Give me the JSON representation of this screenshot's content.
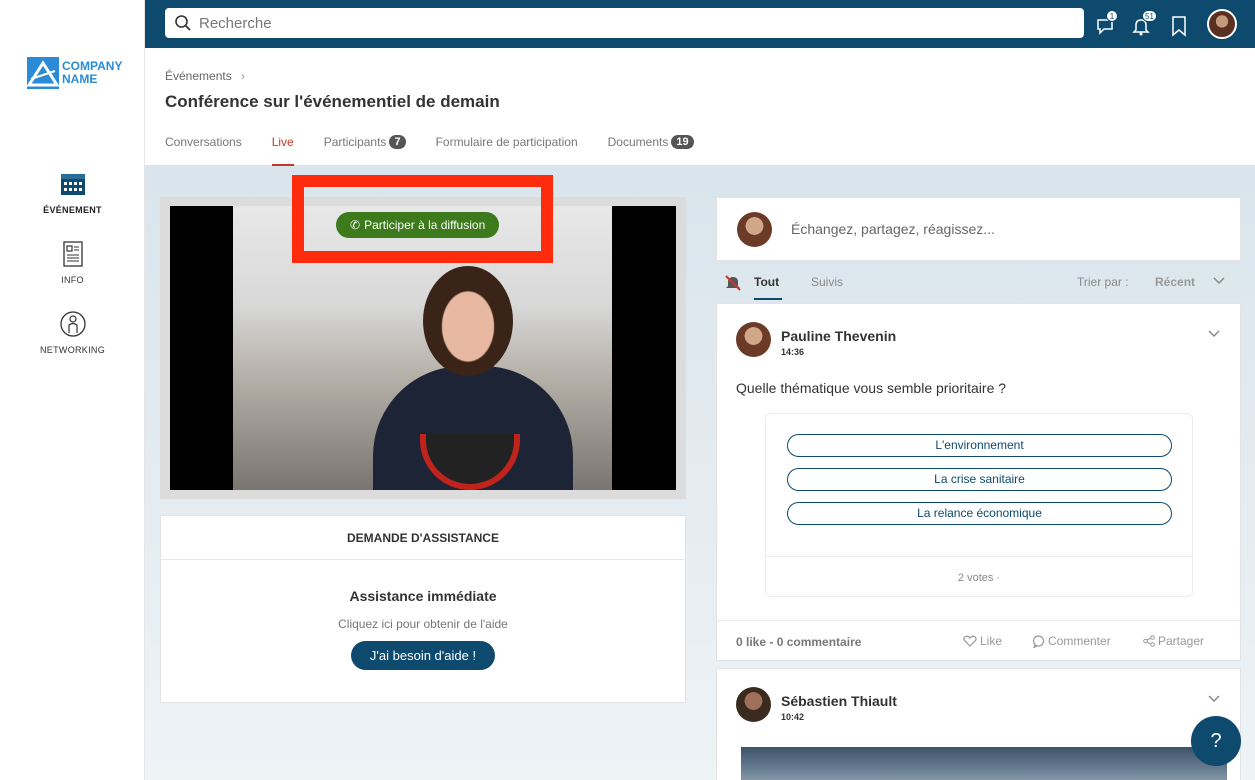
{
  "app": {
    "logo_line1": "COMPANY",
    "logo_line2": "NAME",
    "brand_color": "#0e4a6e",
    "accent_color": "#c0392b"
  },
  "sidebar": {
    "items": [
      {
        "label": "ÉVÉNEMENT",
        "icon": "calendar-icon",
        "active": true
      },
      {
        "label": "INFO",
        "icon": "document-icon",
        "active": false
      },
      {
        "label": "NETWORKING",
        "icon": "person-icon",
        "active": false
      }
    ]
  },
  "topbar": {
    "search_placeholder": "Recherche",
    "messages_count": "1",
    "notifications_count": "51"
  },
  "header": {
    "breadcrumb": "Événements",
    "title": "Conférence sur l'événementiel de demain",
    "tabs": [
      {
        "label": "Conversations",
        "count": null,
        "active": false
      },
      {
        "label": "Live",
        "count": null,
        "active": true
      },
      {
        "label": "Participants",
        "count": "7",
        "active": false
      },
      {
        "label": "Formulaire de participation",
        "count": null,
        "active": false
      },
      {
        "label": "Documents",
        "count": "19",
        "active": false
      }
    ]
  },
  "live": {
    "broadcast_button": "Participer à la diffusion"
  },
  "assistance": {
    "header": "DEMANDE D'ASSISTANCE",
    "title": "Assistance immédiate",
    "subtitle": "Cliquez ici pour obtenir de l'aide",
    "button": "J'ai besoin d'aide !"
  },
  "feed": {
    "composer_placeholder": "Échangez, partagez, réagissez...",
    "filter_all": "Tout",
    "filter_followed": "Suivis",
    "sort_label": "Trier par :",
    "sort_value": "Récent",
    "posts": [
      {
        "author": "Pauline Thevenin",
        "time": "14:36",
        "question": "Quelle thématique vous semble prioritaire ?",
        "options": [
          "L'environnement",
          "La crise sanitaire",
          "La relance économique"
        ],
        "votes": "2 votes ·",
        "likes": "0 like",
        "comments": "0 commentaire",
        "like_label": "Like",
        "comment_label": "Commenter",
        "share_label": "Partager"
      },
      {
        "author": "Sébastien Thiault",
        "time": "10:42"
      }
    ]
  },
  "help_fab": "?"
}
